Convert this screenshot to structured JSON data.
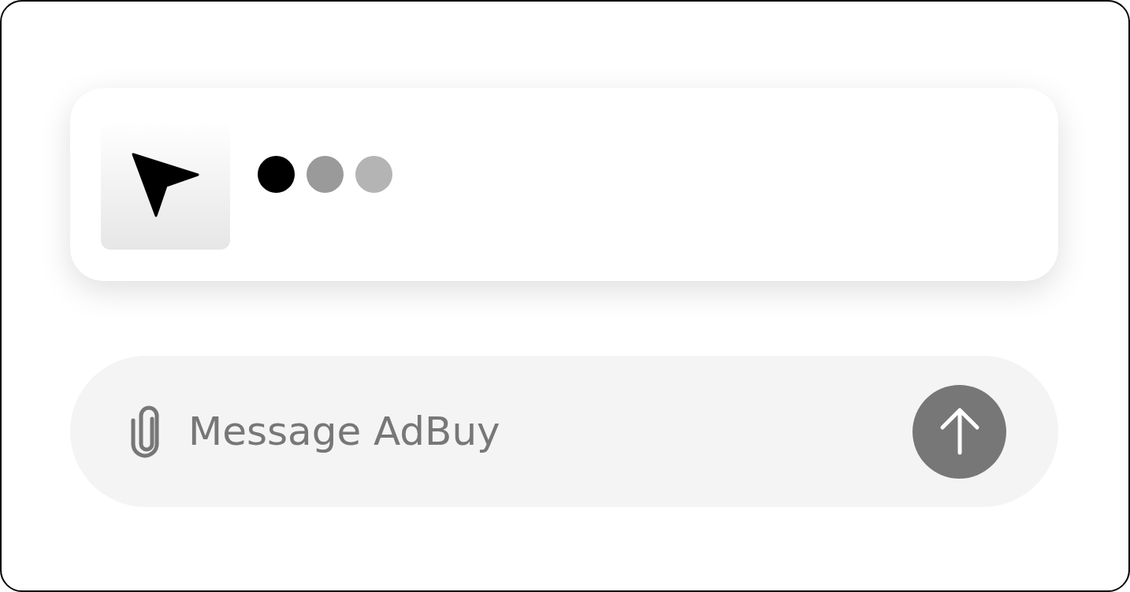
{
  "message": {
    "typing": true
  },
  "composer": {
    "placeholder": "Message AdBuy"
  }
}
